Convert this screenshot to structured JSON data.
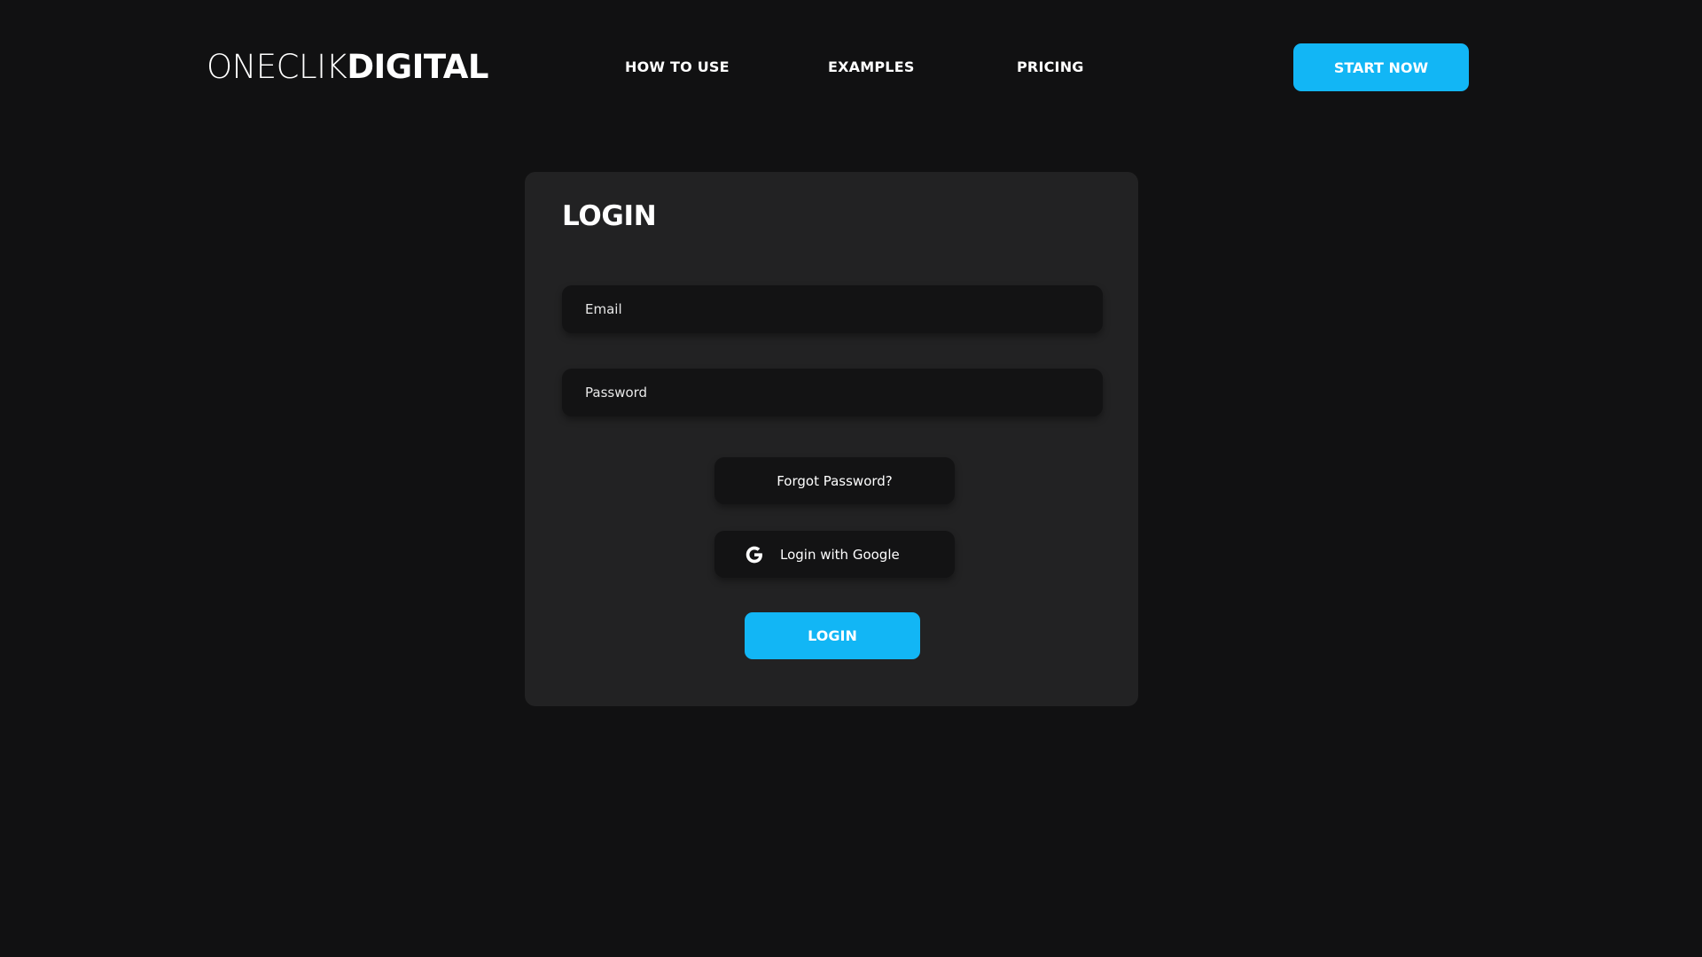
{
  "header": {
    "logo": {
      "light": "ONECLIK",
      "bold": "DIGITAL"
    },
    "nav": [
      {
        "label": "HOW TO USE"
      },
      {
        "label": "EXAMPLES"
      },
      {
        "label": "PRICING"
      }
    ],
    "cta_label": "START NOW"
  },
  "login": {
    "title": "LOGIN",
    "email_placeholder": "Email",
    "password_placeholder": "Password",
    "forgot_label": "Forgot Password?",
    "google_label": "Login with Google",
    "submit_label": "LOGIN"
  },
  "colors": {
    "background": "#111112",
    "card": "#222223",
    "field": "#131314",
    "accent": "#12b6f5",
    "text": "#ffffff"
  },
  "icons": {
    "google": "google-g-icon"
  }
}
